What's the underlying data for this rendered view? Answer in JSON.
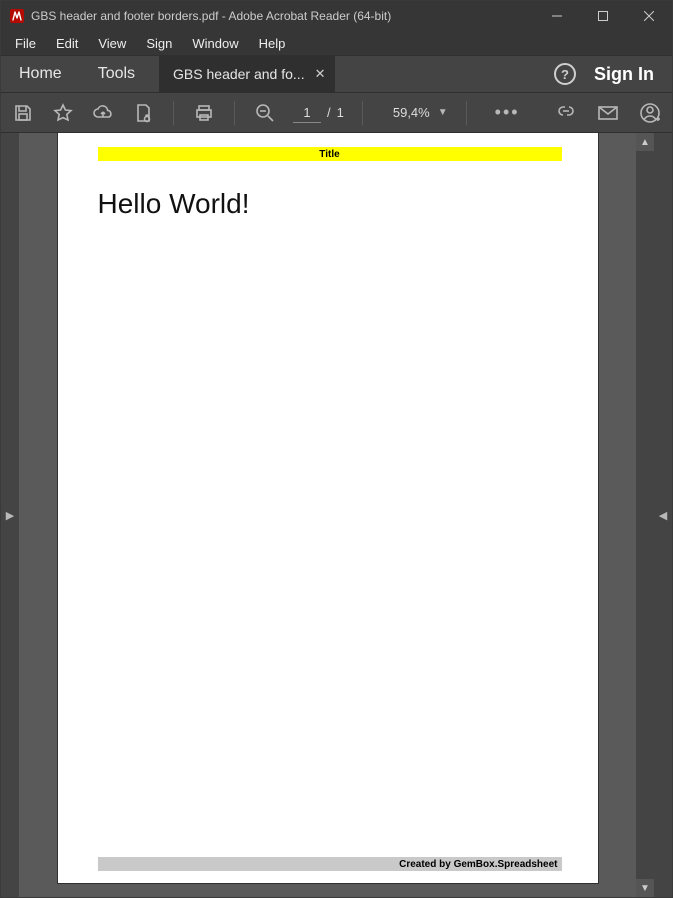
{
  "window": {
    "title": "GBS header and footer borders.pdf - Adobe Acrobat Reader (64-bit)"
  },
  "menu": {
    "file": "File",
    "edit": "Edit",
    "view": "View",
    "sign": "Sign",
    "window": "Window",
    "help": "Help"
  },
  "tabs": {
    "home": "Home",
    "tools": "Tools",
    "document": "GBS header and fo..."
  },
  "header": {
    "help_glyph": "?",
    "signin": "Sign In"
  },
  "toolbar": {
    "page_current": "1",
    "page_sep": "/",
    "page_total": "1",
    "zoom": "59,4%",
    "dots": "•••"
  },
  "document": {
    "header_text": "Title",
    "body_text": "Hello World!",
    "footer_text": "Created by GemBox.Spreadsheet"
  }
}
